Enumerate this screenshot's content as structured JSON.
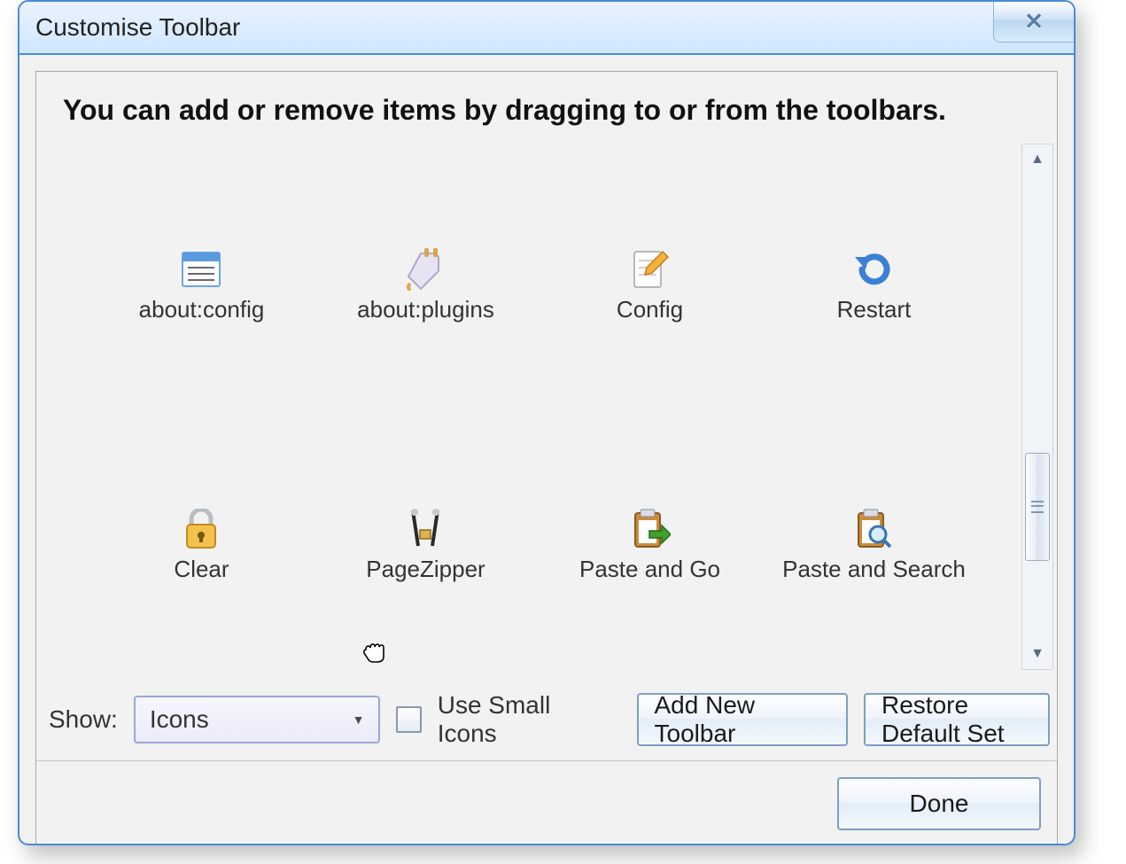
{
  "window": {
    "title": "Customise Toolbar",
    "instruction": "You can add or remove items by dragging to or from the toolbars."
  },
  "items": [
    {
      "label": "about:config",
      "icon": "config-list-icon"
    },
    {
      "label": "about:plugins",
      "icon": "plugin-icon"
    },
    {
      "label": "Config",
      "icon": "edit-page-icon"
    },
    {
      "label": "Restart",
      "icon": "restart-icon"
    },
    {
      "label": "Clear",
      "icon": "lock-icon"
    },
    {
      "label": "PageZipper",
      "icon": "pagezipper-icon"
    },
    {
      "label": "Paste and Go",
      "icon": "paste-go-icon"
    },
    {
      "label": "Paste and Search",
      "icon": "paste-search-icon"
    }
  ],
  "controls": {
    "show_label": "Show:",
    "show_value": "Icons",
    "small_icons_label": "Use Small Icons",
    "add_toolbar_label": "Add New Toolbar",
    "restore_label": "Restore Default Set",
    "done_label": "Done"
  }
}
